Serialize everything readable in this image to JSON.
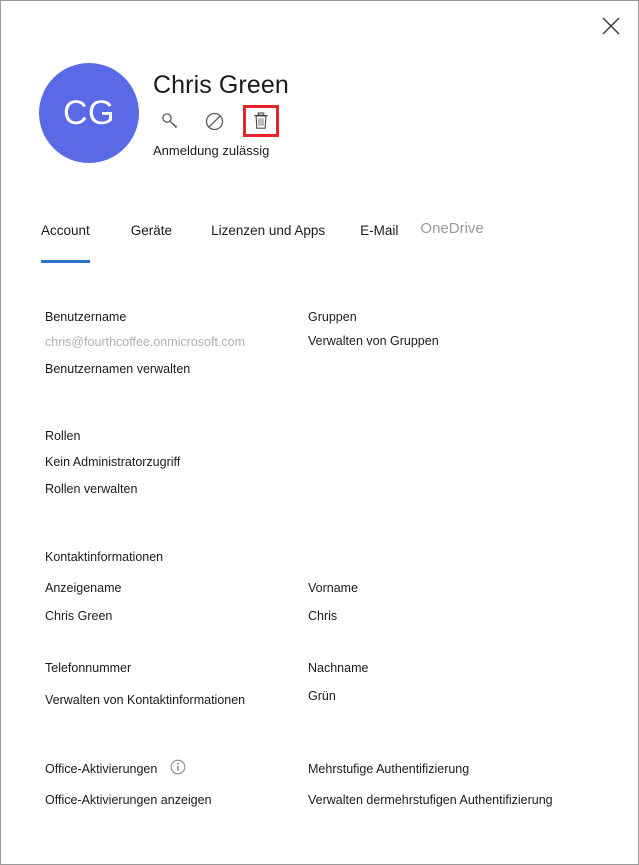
{
  "window": {
    "close_label": "×"
  },
  "header": {
    "avatar_initials": "CG",
    "user_name": "Chris Green",
    "signin_status": "Anmeldung zulässig",
    "avatar_color": "#5a6ae6",
    "actions": [
      {
        "name": "reset-password",
        "icon": "key-icon"
      },
      {
        "name": "block-signin",
        "icon": "block-icon"
      },
      {
        "name": "delete-user",
        "icon": "trash-icon",
        "highlight_color": "#e8242a"
      }
    ]
  },
  "tabs": {
    "active_index": 0,
    "accent_color": "#2b73c4",
    "items": [
      {
        "label": "Account",
        "muted": false
      },
      {
        "label": "Geräte",
        "muted": false
      },
      {
        "label": "Lizenzen und Apps",
        "muted": false
      },
      {
        "label": "E-Mail",
        "muted": false
      },
      {
        "label": "OneDrive",
        "muted": true
      }
    ]
  },
  "content": {
    "username_label": "Benutzername",
    "username_value": "chris@fourthcoffee.onmicrosoft.com",
    "username_link": "Benutzernamen verwalten",
    "groups_label": "Gruppen",
    "groups_link": "Verwalten von Gruppen",
    "roles_label": "Rollen",
    "roles_value": "Kein Administratorzugriff",
    "roles_link": "Rollen verwalten",
    "contact_heading": "Kontaktinformationen",
    "displayname_label": "Anzeigename",
    "displayname_value": "Chris Green",
    "firstname_label": "Vorname",
    "firstname_value": "Chris",
    "phone_label": "Telefonnummer",
    "contact_link": "Verwalten von Kontaktinformationen",
    "lastname_label": "Nachname",
    "lastname_value": "Grün",
    "office_label": "Office-Aktivierungen",
    "office_link": "Office-Aktivierungen anzeigen",
    "office_info_icon": "info-icon",
    "mfa_label": "Mehrstufige Authentifizierung",
    "mfa_link": "Verwalten dermehrstufigen Authentifizierung"
  }
}
